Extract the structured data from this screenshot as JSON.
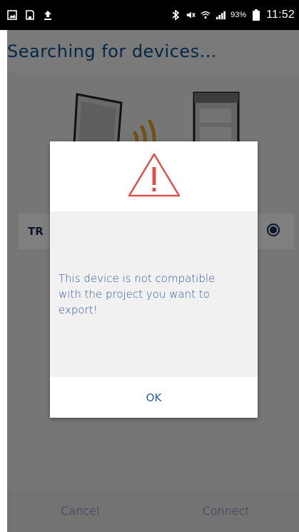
{
  "status_bar": {
    "time": "11:52",
    "battery": "93%",
    "left_icons": [
      "image-icon",
      "save-icon",
      "upload-icon"
    ],
    "right_icons": [
      "bluetooth-icon",
      "mute-icon",
      "wifi-icon",
      "signal-icon",
      "battery-icon"
    ]
  },
  "header": {
    "title": "Searching for devices..."
  },
  "device_list": {
    "items": [
      {
        "name": "TR",
        "selected": true
      }
    ]
  },
  "dialog": {
    "icon": "warning-triangle-icon",
    "message": "This device is not compatible with the project you want to export!",
    "ok_label": "OK"
  },
  "footer": {
    "cancel_label": "Cancel",
    "connect_label": "Connect"
  },
  "colors": {
    "title": "#0d4f8f",
    "accent_orange": "#e0a028",
    "warning_red": "#d9534f",
    "dialog_text": "#2d5c9a"
  }
}
